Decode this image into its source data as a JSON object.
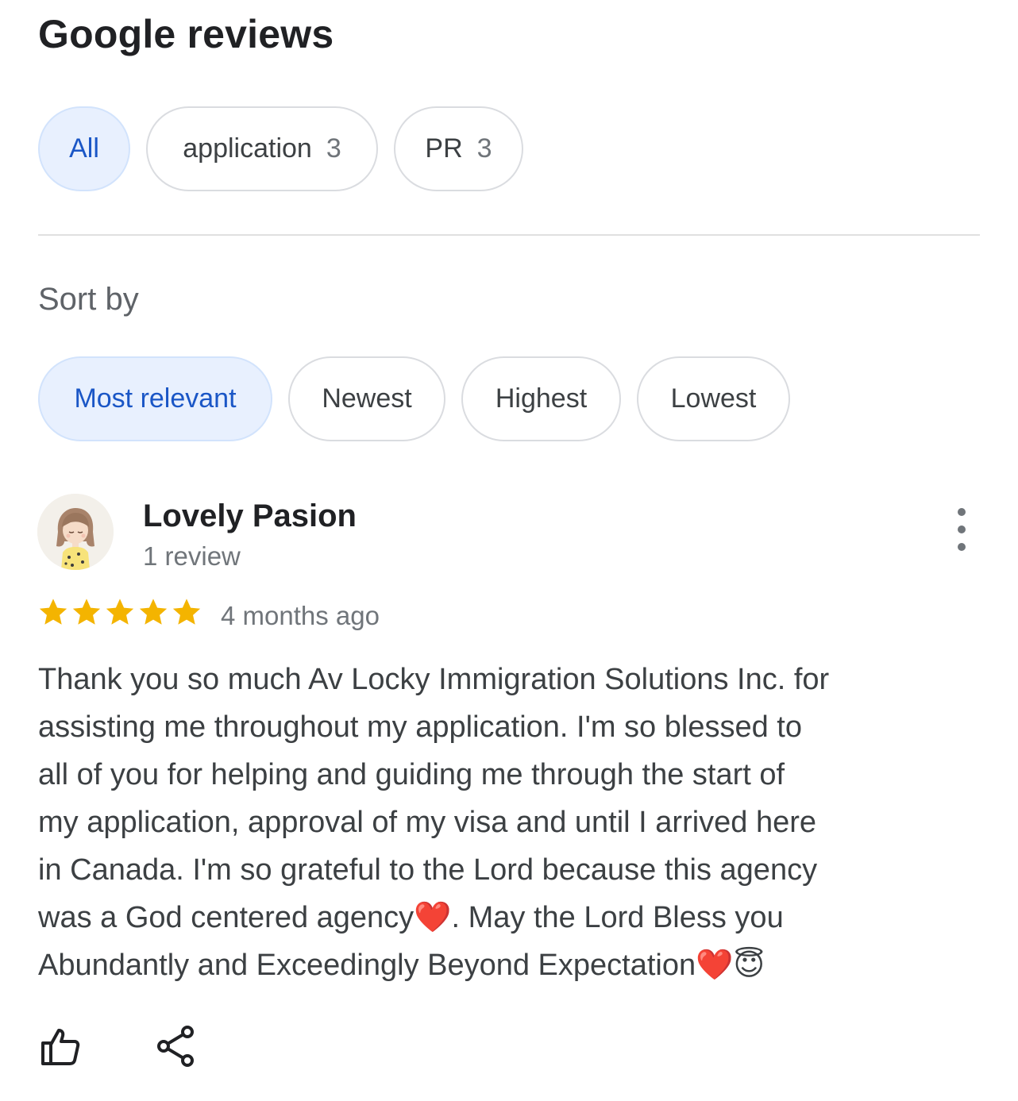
{
  "header": {
    "title": "Google reviews"
  },
  "topic_filters": [
    {
      "label": "All",
      "count": "",
      "selected": true
    },
    {
      "label": "application",
      "count": "3",
      "selected": false
    },
    {
      "label": "PR",
      "count": "3",
      "selected": false
    }
  ],
  "sort": {
    "label": "Sort by",
    "options": [
      {
        "label": "Most relevant",
        "selected": true
      },
      {
        "label": "Newest",
        "selected": false
      },
      {
        "label": "Highest",
        "selected": false
      },
      {
        "label": "Lowest",
        "selected": false
      }
    ]
  },
  "review": {
    "reviewer_name": "Lovely Pasion",
    "reviewer_reviews": "1 review",
    "rating": 5,
    "rating_max": 5,
    "time_ago": "4 months ago",
    "text": "Thank you so much Av Locky Immigration Solutions Inc. for\nassisting me throughout my application. I'm so blessed to\nall of you for helping and guiding me through the start of\nmy application, approval of my visa and until I arrived here\nin Canada. I'm so  grateful to the Lord because this agency\nwas a God centered agency❤️. May the Lord Bless you\nAbundantly and Exceedingly Beyond Expectation❤️😇"
  },
  "colors": {
    "selected_chip_bg": "#e8f0fe",
    "selected_chip_text": "#1a56c6",
    "star": "#f4b400",
    "muted_text": "#70757a"
  },
  "icons": {
    "more": "more-vert-icon",
    "like": "thumbs-up-icon",
    "share": "share-icon",
    "star": "star-icon"
  }
}
